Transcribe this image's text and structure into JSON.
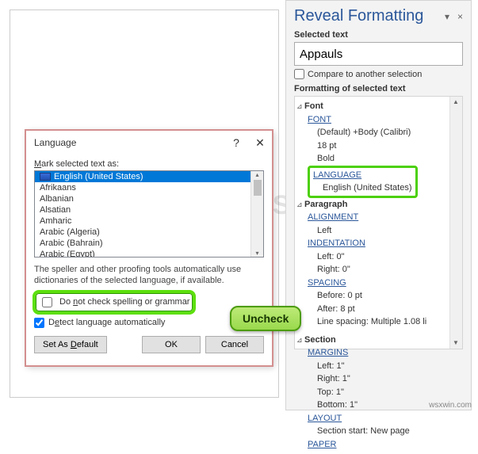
{
  "pane": {
    "title": "Reveal Formatting",
    "close_glyph": "×",
    "menu_glyph": "▾",
    "selected_text_label": "Selected text",
    "selected_text_value": "Appauls",
    "compare_label": "Compare to another selection",
    "fmt_label": "Formatting of selected text",
    "font_section": "Font",
    "font_link": "FONT",
    "font_val1": "(Default) +Body (Calibri)",
    "font_val2": "18 pt",
    "font_val3": "Bold",
    "lang_link": "LANGUAGE",
    "lang_val": "English (United States)",
    "para_section": "Paragraph",
    "align_link": "ALIGNMENT",
    "align_val": "Left",
    "indent_link": "INDENTATION",
    "indent_l": "Left:  0\"",
    "indent_r": "Right:  0\"",
    "spacing_link": "SPACING",
    "spacing_b": "Before:  0 pt",
    "spacing_a": "After:  8 pt",
    "spacing_ls": "Line spacing:  Multiple 1.08 li",
    "sect_section": "Section",
    "margins_link": "MARGINS",
    "m_l": "Left:  1\"",
    "m_r": "Right:  1\"",
    "m_t": "Top:  1\"",
    "m_b": "Bottom:  1\"",
    "layout_link": "LAYOUT",
    "layout_val": "Section start: New page",
    "paper_link": "PAPER"
  },
  "dlg": {
    "title": "Language",
    "help": "?",
    "close": "✕",
    "mark_label_pre": "",
    "mark_label": "Mark selected text as:",
    "items": [
      "English (United States)",
      "Afrikaans",
      "Albanian",
      "Alsatian",
      "Amharic",
      "Arabic (Algeria)",
      "Arabic (Bahrain)",
      "Arabic (Egypt)"
    ],
    "speller": "The speller and other proofing tools automatically use dictionaries of the selected language, if available.",
    "no_check": "Do not check spelling or grammar",
    "detect": "Detect language automatically",
    "set_default": "Set As Default",
    "ok": "OK",
    "cancel": "Cancel"
  },
  "callout": "Uncheck",
  "watermark": "A   PPUALS",
  "credit": "wsxwin.com"
}
